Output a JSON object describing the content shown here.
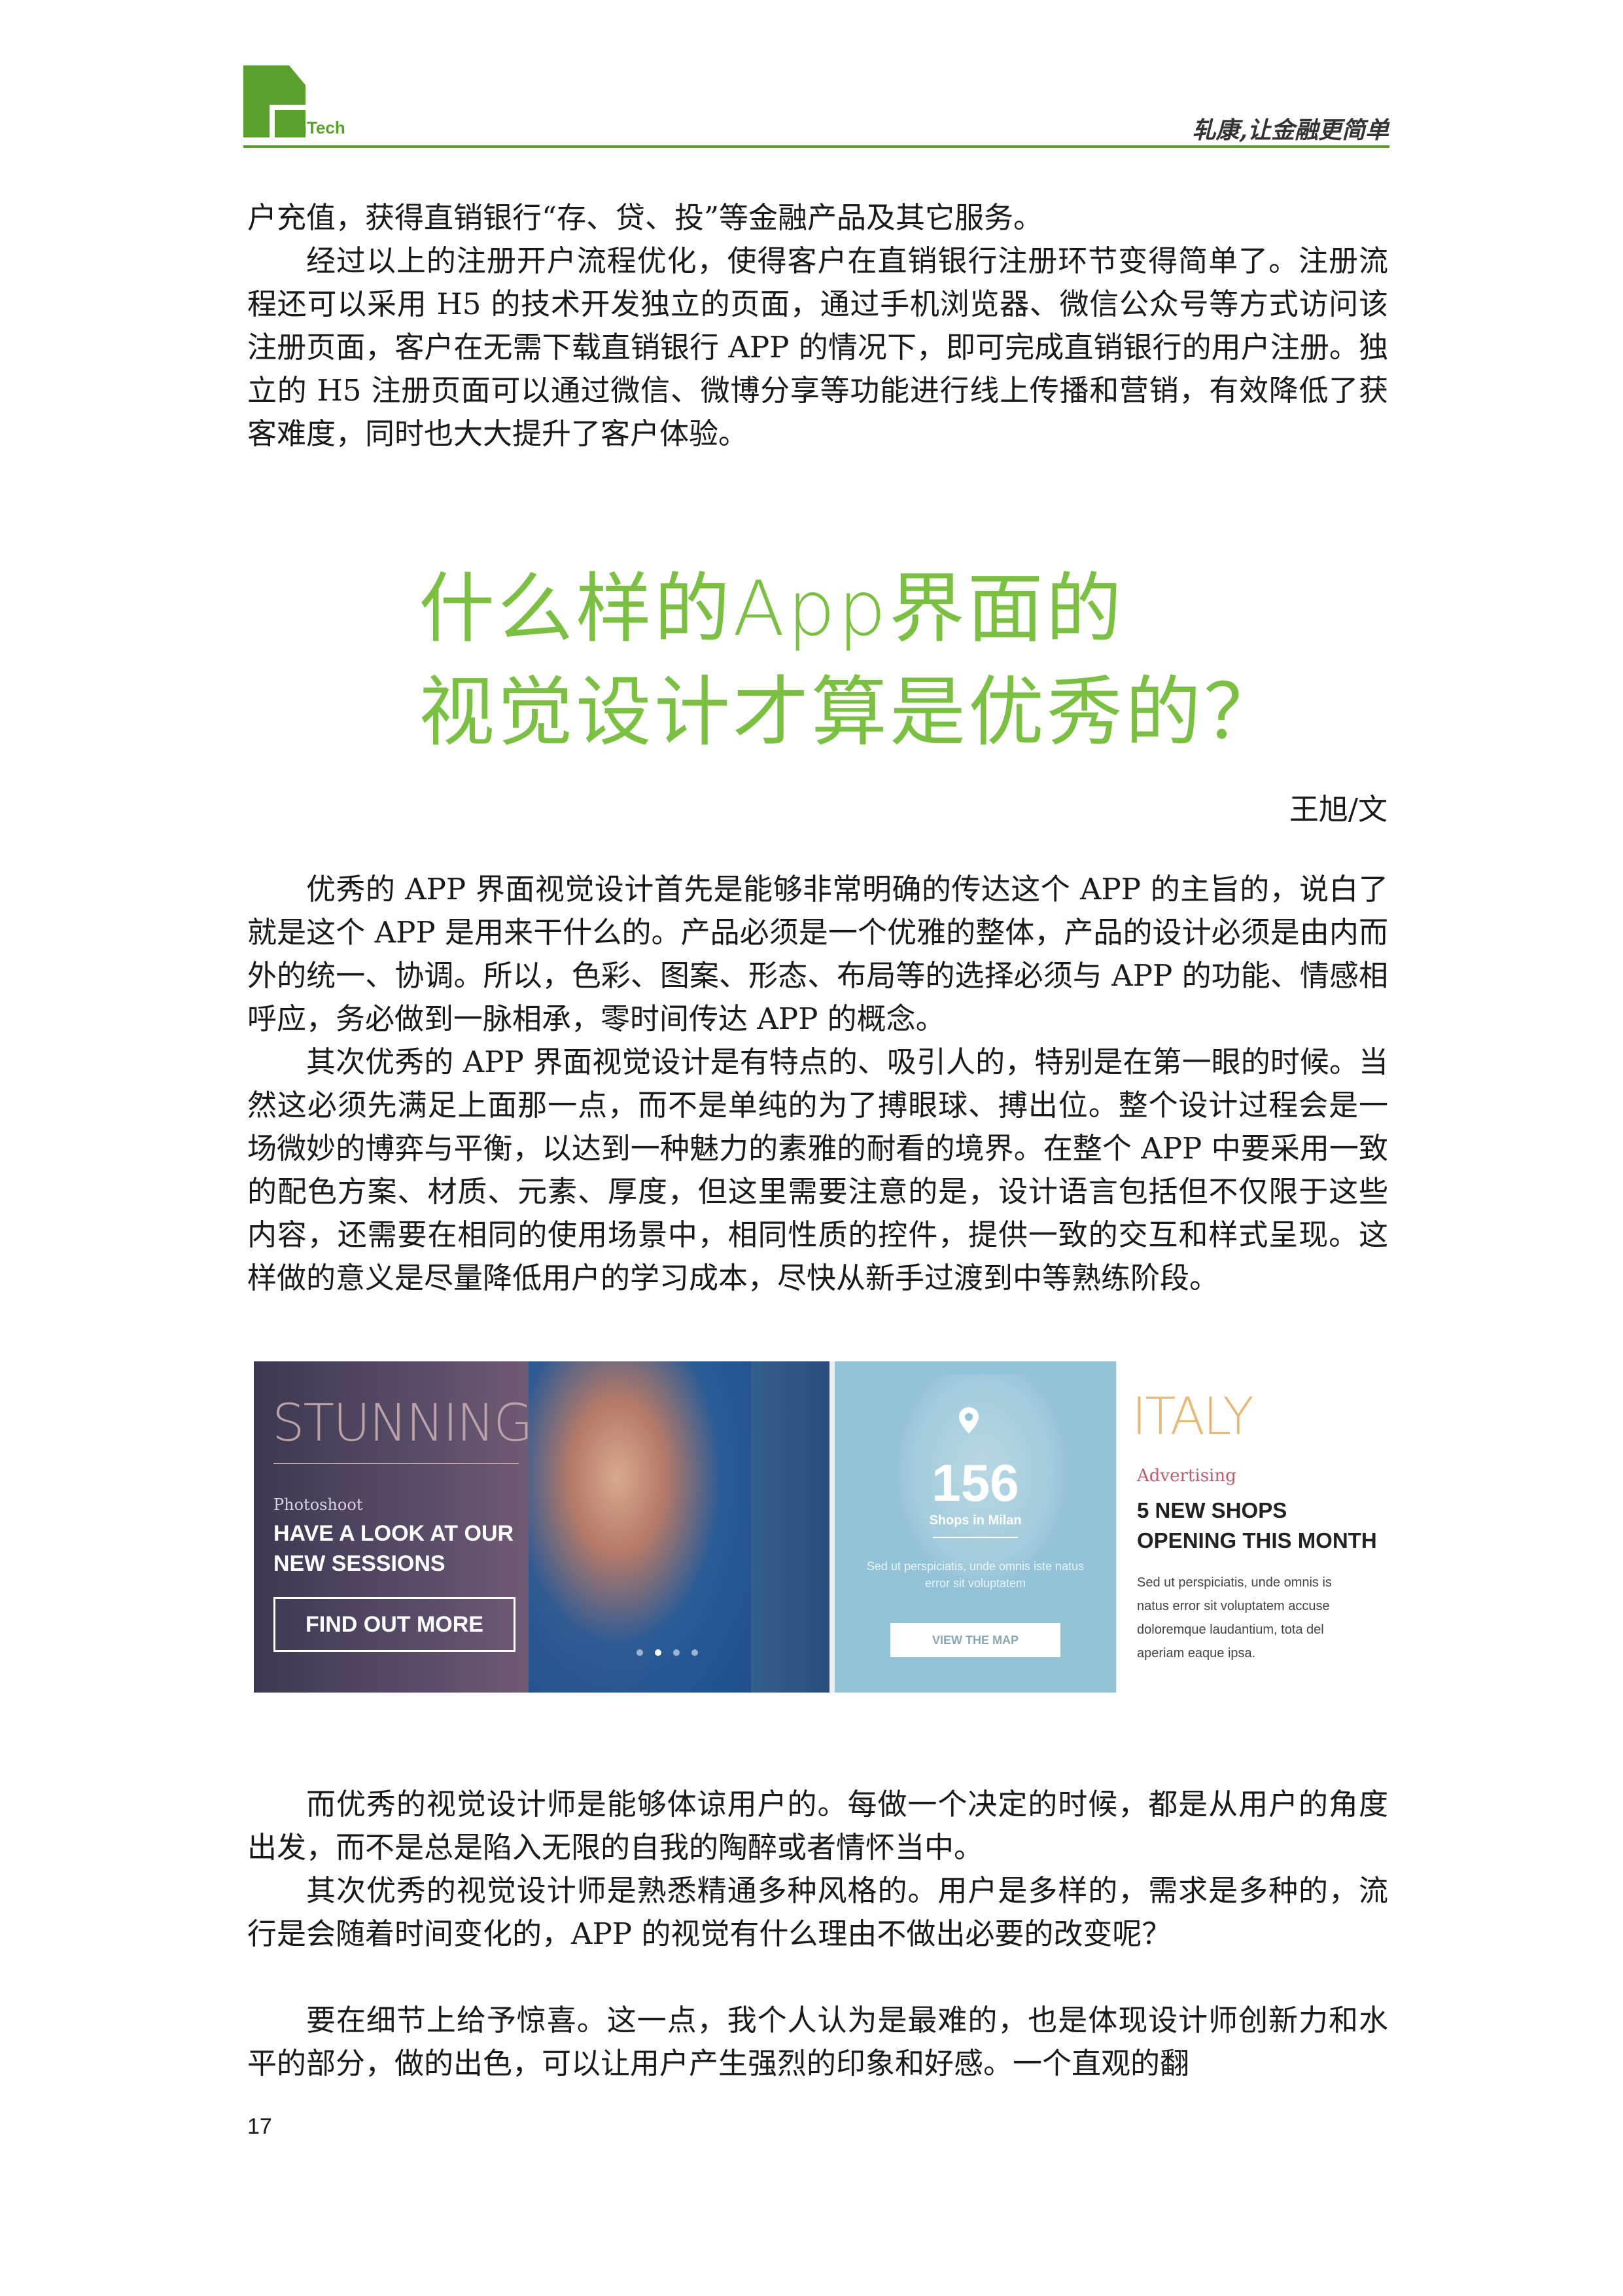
{
  "header": {
    "logo_text": "FinTech",
    "slogan": "轧康,让金融更简单",
    "brand_color": "#5aa02c"
  },
  "intro_paragraphs": [
    "户充值，获得直销银行“存、贷、投”等金融产品及其它服务。",
    "经过以上的注册开户流程优化，使得客户在直销银行注册环节变得简单了。注册流程还可以采用 H5 的技术开发独立的页面，通过手机浏览器、微信公众号等方式访问该注册页面，客户在无需下载直销银行 APP 的情况下，即可完成直销银行的用户注册。独立的 H5 注册页面可以通过微信、微博分享等功能进行线上传播和营销，有效降低了获客难度，同时也大大提升了客户体验。"
  ],
  "article": {
    "title_line1": "什么样的App界面的",
    "title_line2": "视觉设计才算是优秀的？",
    "title_color": "#7bc043",
    "author": "王旭/文"
  },
  "body_paragraphs": [
    "优秀的 APP 界面视觉设计首先是能够非常明确的传达这个 APP 的主旨的，说白了就是这个 APP 是用来干什么的。产品必须是一个优雅的整体，产品的设计必须是由内而外的统一、协调。所以，色彩、图案、形态、布局等的选择必须与 APP 的功能、情感相呼应，务必做到一脉相承，零时间传达 APP 的概念。",
    "其次优秀的 APP 界面视觉设计是有特点的、吸引人的，特别是在第一眼的时候。当然这必须先满足上面那一点，而不是单纯的为了搏眼球、搏出位。整个设计过程会是一场微妙的博弈与平衡，以达到一种魅力的素雅的耐看的境界。在整个 APP 中要采用一致的配色方案、材质、元素、厚度，但这里需要注意的是，设计语言包括但不仅限于这些内容，还需要在相同的使用场景中，相同性质的控件，提供一致的交互和样式呈现。这样做的意义是尽量降低用户的学习成本，尽快从新手过渡到中等熟练阶段。"
  ],
  "banner": {
    "stunning": "STUNNING",
    "photoshoot": "Photoshoot",
    "look": "HAVE A LOOK AT OUR NEW SESSIONS",
    "find_out": "FIND OUT MORE",
    "count": "156",
    "shops_in": "Shops in Milan",
    "sed_b": "Sed ut perspiciatis, unde omnis iste natus error sit voluptatem",
    "view_map": "VIEW THE MAP",
    "italy": "ITALY",
    "advertising": "Advertising",
    "new_shops": "5 NEW SHOPS OPENING THIS MONTH",
    "sed_c": "Sed ut perspiciatis, unde omnis is natus error sit voluptatem accuse doloremque laudantium, tota del aperiam eaque ipsa."
  },
  "closing_paragraphs": [
    "而优秀的视觉设计师是能够体谅用户的。每做一个决定的时候，都是从用户的角度出发，而不是总是陷入无限的自我的陶醉或者情怀当中。",
    "其次优秀的视觉设计师是熟悉精通多种风格的。用户是多样的，需求是多种的，流行是会随着时间变化的，APP 的视觉有什么理由不做出必要的改变呢？",
    "要在细节上给予惊喜。这一点，我个人认为是最难的，也是体现设计师创新力和水平的部分，做的出色，可以让用户产生强烈的印象和好感。一个直观的翻"
  ],
  "page_number": "17"
}
